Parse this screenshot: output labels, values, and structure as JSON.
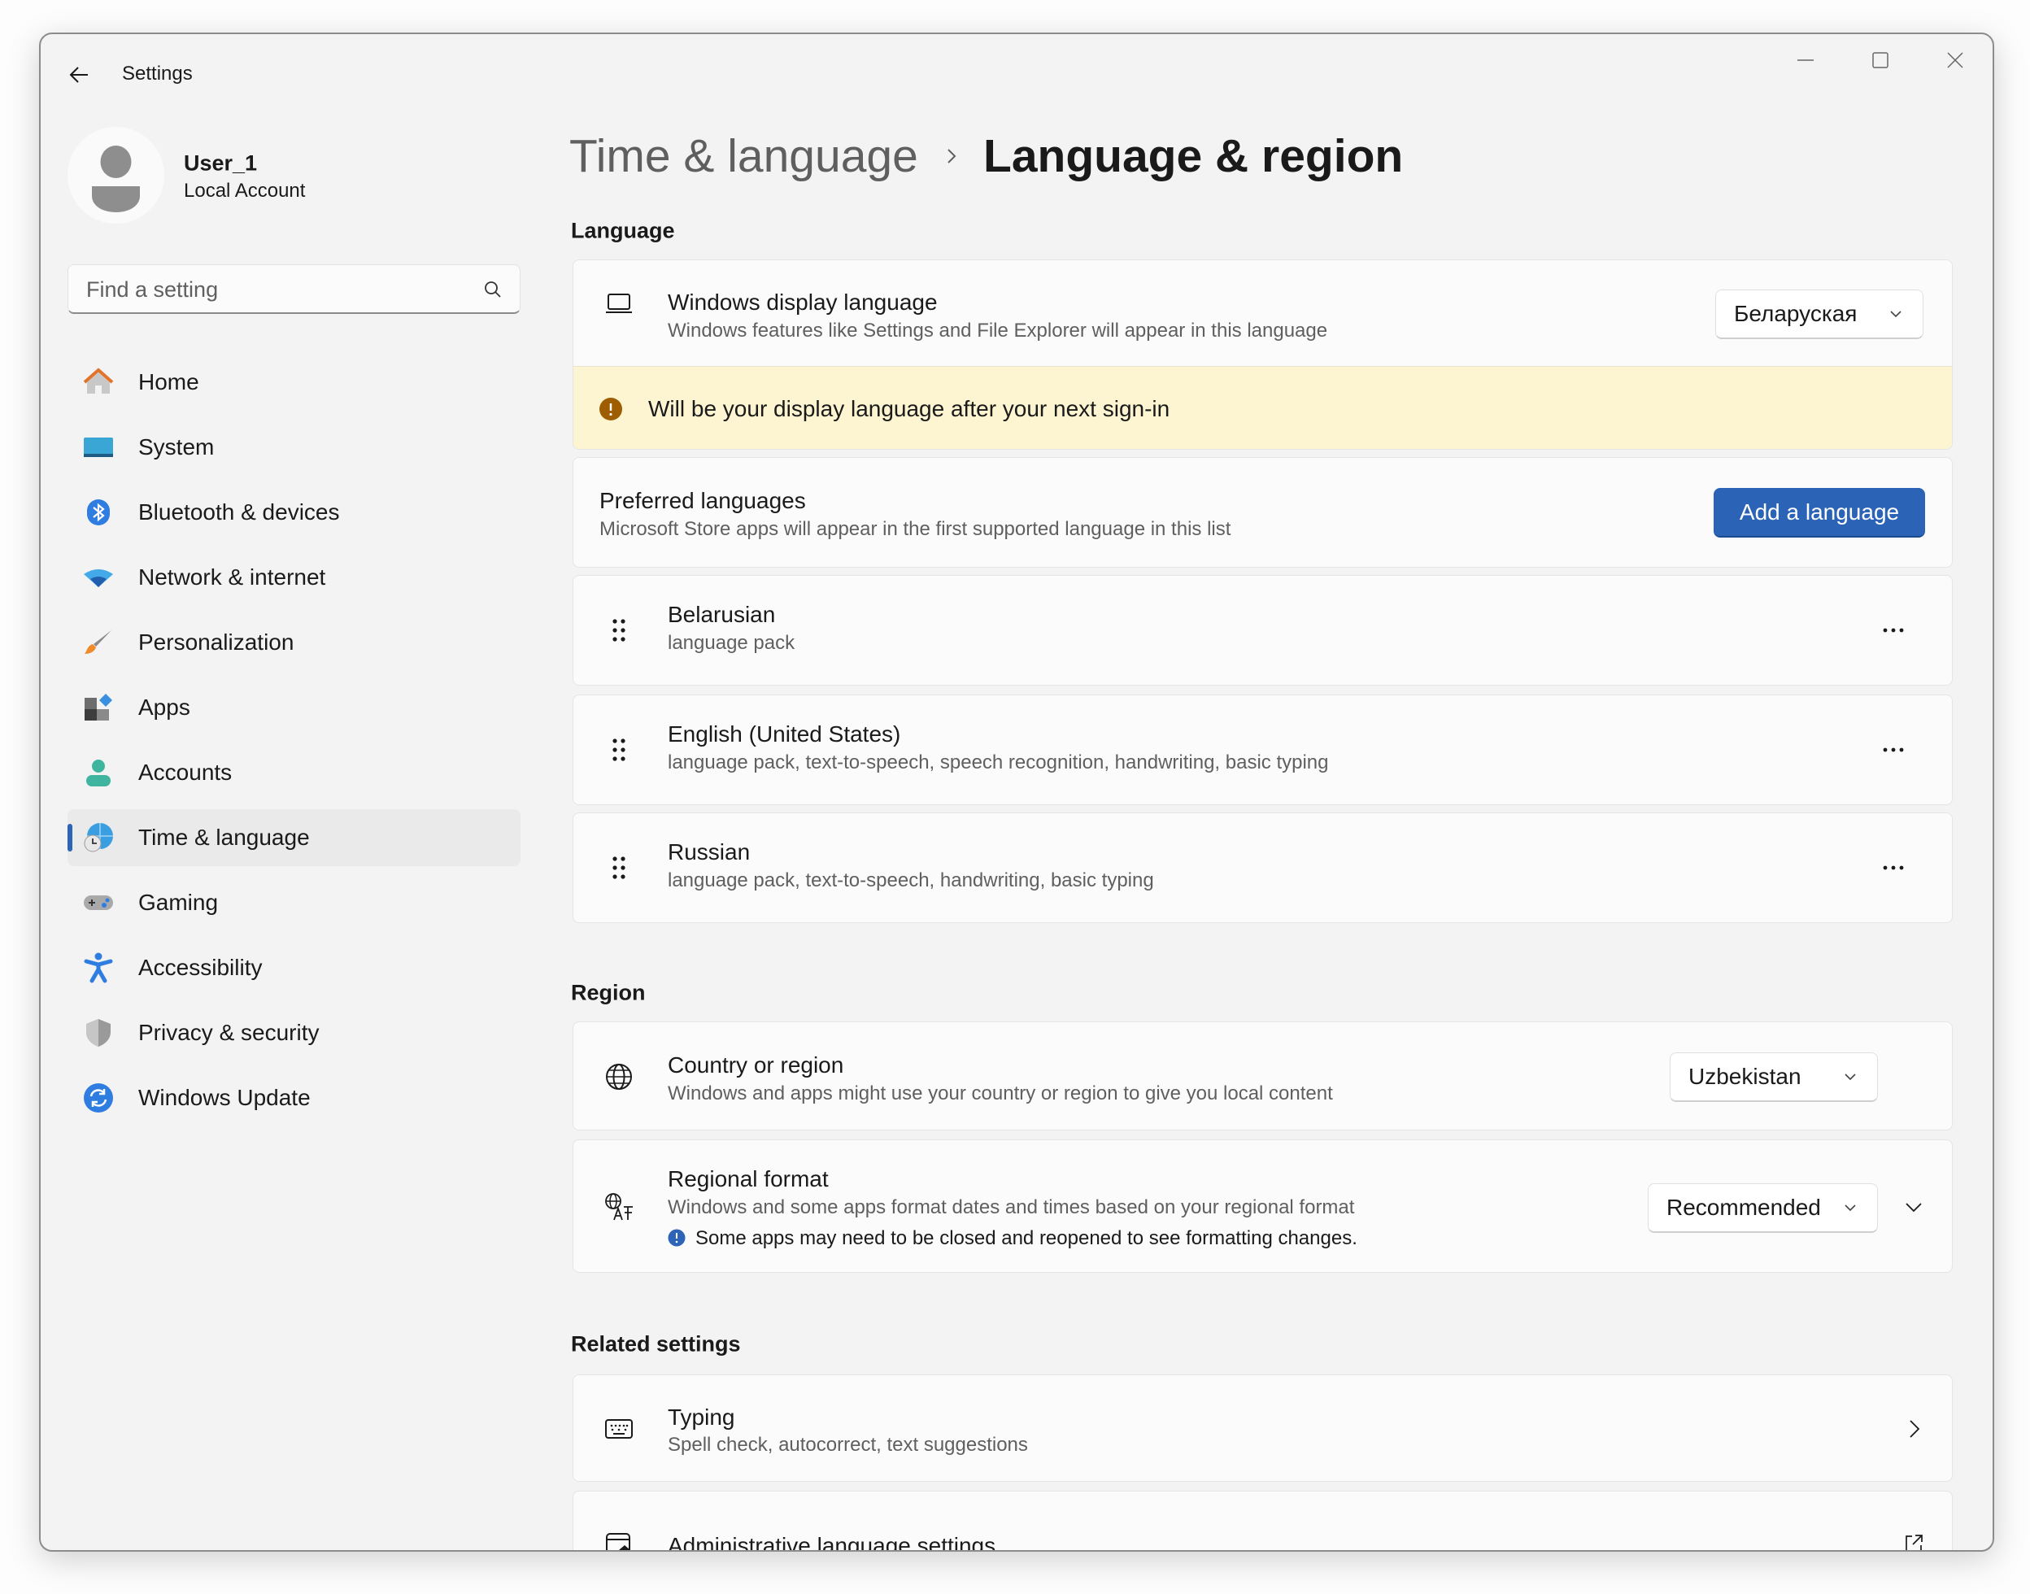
{
  "window": {
    "title": "Settings",
    "controls": {
      "minimize": "minimize-icon",
      "maximize": "maximize-icon",
      "close": "close-icon"
    }
  },
  "user": {
    "name": "User_1",
    "account_type": "Local Account"
  },
  "search": {
    "placeholder": "Find a setting"
  },
  "sidebar": {
    "items": [
      {
        "label": "Home",
        "icon": "home-icon"
      },
      {
        "label": "System",
        "icon": "system-icon"
      },
      {
        "label": "Bluetooth & devices",
        "icon": "bluetooth-icon"
      },
      {
        "label": "Network & internet",
        "icon": "wifi-icon"
      },
      {
        "label": "Personalization",
        "icon": "brush-icon"
      },
      {
        "label": "Apps",
        "icon": "apps-icon"
      },
      {
        "label": "Accounts",
        "icon": "accounts-icon"
      },
      {
        "label": "Time & language",
        "icon": "time-language-icon",
        "selected": true
      },
      {
        "label": "Gaming",
        "icon": "gamepad-icon"
      },
      {
        "label": "Accessibility",
        "icon": "accessibility-icon"
      },
      {
        "label": "Privacy & security",
        "icon": "shield-icon"
      },
      {
        "label": "Windows Update",
        "icon": "update-icon"
      }
    ]
  },
  "breadcrumb": {
    "parent": "Time & language",
    "current": "Language & region"
  },
  "language": {
    "header": "Language",
    "display": {
      "title": "Windows display language",
      "subtitle": "Windows features like Settings and File Explorer will appear in this language",
      "value": "Беларуская"
    },
    "banner": "Will be your display language after your next sign-in",
    "preferred": {
      "title": "Preferred languages",
      "subtitle": "Microsoft Store apps will appear in the first supported language in this list",
      "button": "Add a language"
    },
    "list": [
      {
        "name": "Belarusian",
        "features": "language pack"
      },
      {
        "name": "English (United States)",
        "features": "language pack, text-to-speech, speech recognition, handwriting, basic typing"
      },
      {
        "name": "Russian",
        "features": "language pack, text-to-speech, handwriting, basic typing"
      }
    ]
  },
  "region": {
    "header": "Region",
    "country": {
      "title": "Country or region",
      "subtitle": "Windows and apps might use your country or region to give you local content",
      "value": "Uzbekistan"
    },
    "format": {
      "title": "Regional format",
      "subtitle": "Windows and some apps format dates and times based on your regional format",
      "info": "Some apps may need to be closed and reopened to see formatting changes.",
      "value": "Recommended"
    }
  },
  "related": {
    "header": "Related settings",
    "typing": {
      "title": "Typing",
      "subtitle": "Spell check, autocorrect, text suggestions"
    },
    "admin": {
      "title": "Administrative language settings"
    }
  },
  "colors": {
    "accent": "#2b63b7",
    "banner": "#fdf5d1",
    "warning": "#9d5d00",
    "info": "#2d64b8"
  }
}
